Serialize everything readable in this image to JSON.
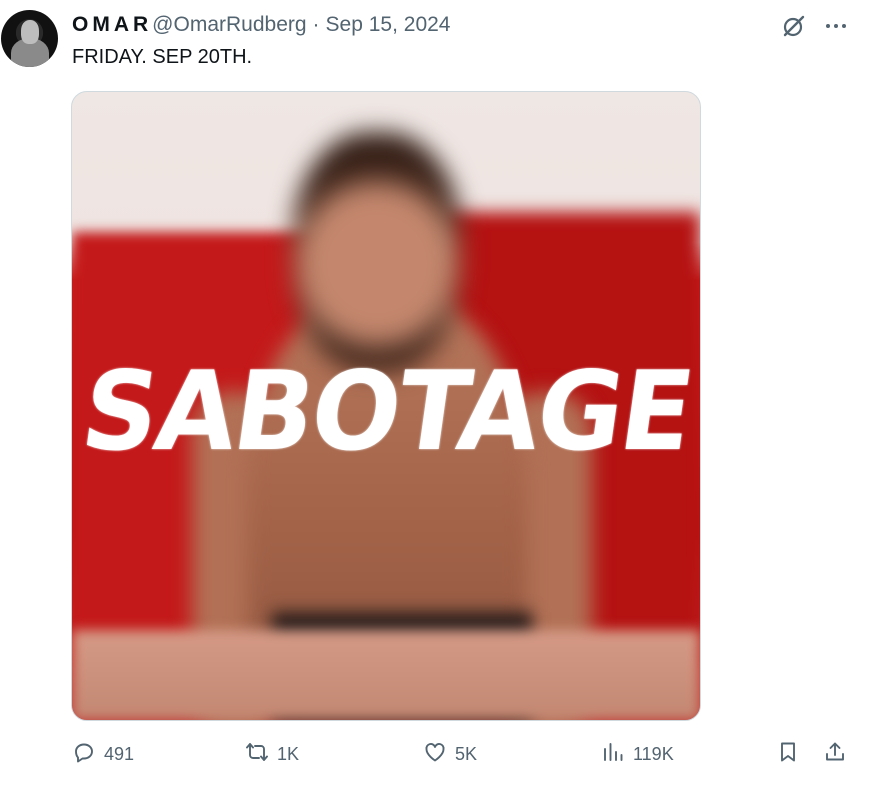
{
  "author": {
    "name": "OMAR",
    "handle": "@OmarRudberg",
    "separator": "·",
    "date": "Sep 15, 2024"
  },
  "tweet": {
    "text": "FRIDAY. SEP 20TH."
  },
  "media": {
    "cover_title": "SABOTAGE"
  },
  "actions": {
    "replies": "491",
    "retweets": "1K",
    "likes": "5K",
    "views": "119K"
  },
  "icons": {
    "grok": "grok-icon",
    "more": "more-icon",
    "reply": "reply-icon",
    "retweet": "retweet-icon",
    "like": "heart-icon",
    "views": "views-icon",
    "bookmark": "bookmark-icon",
    "share": "share-icon"
  },
  "colors": {
    "text_primary": "#0f1419",
    "text_secondary": "#536471",
    "cover_red": "#c4191a"
  }
}
